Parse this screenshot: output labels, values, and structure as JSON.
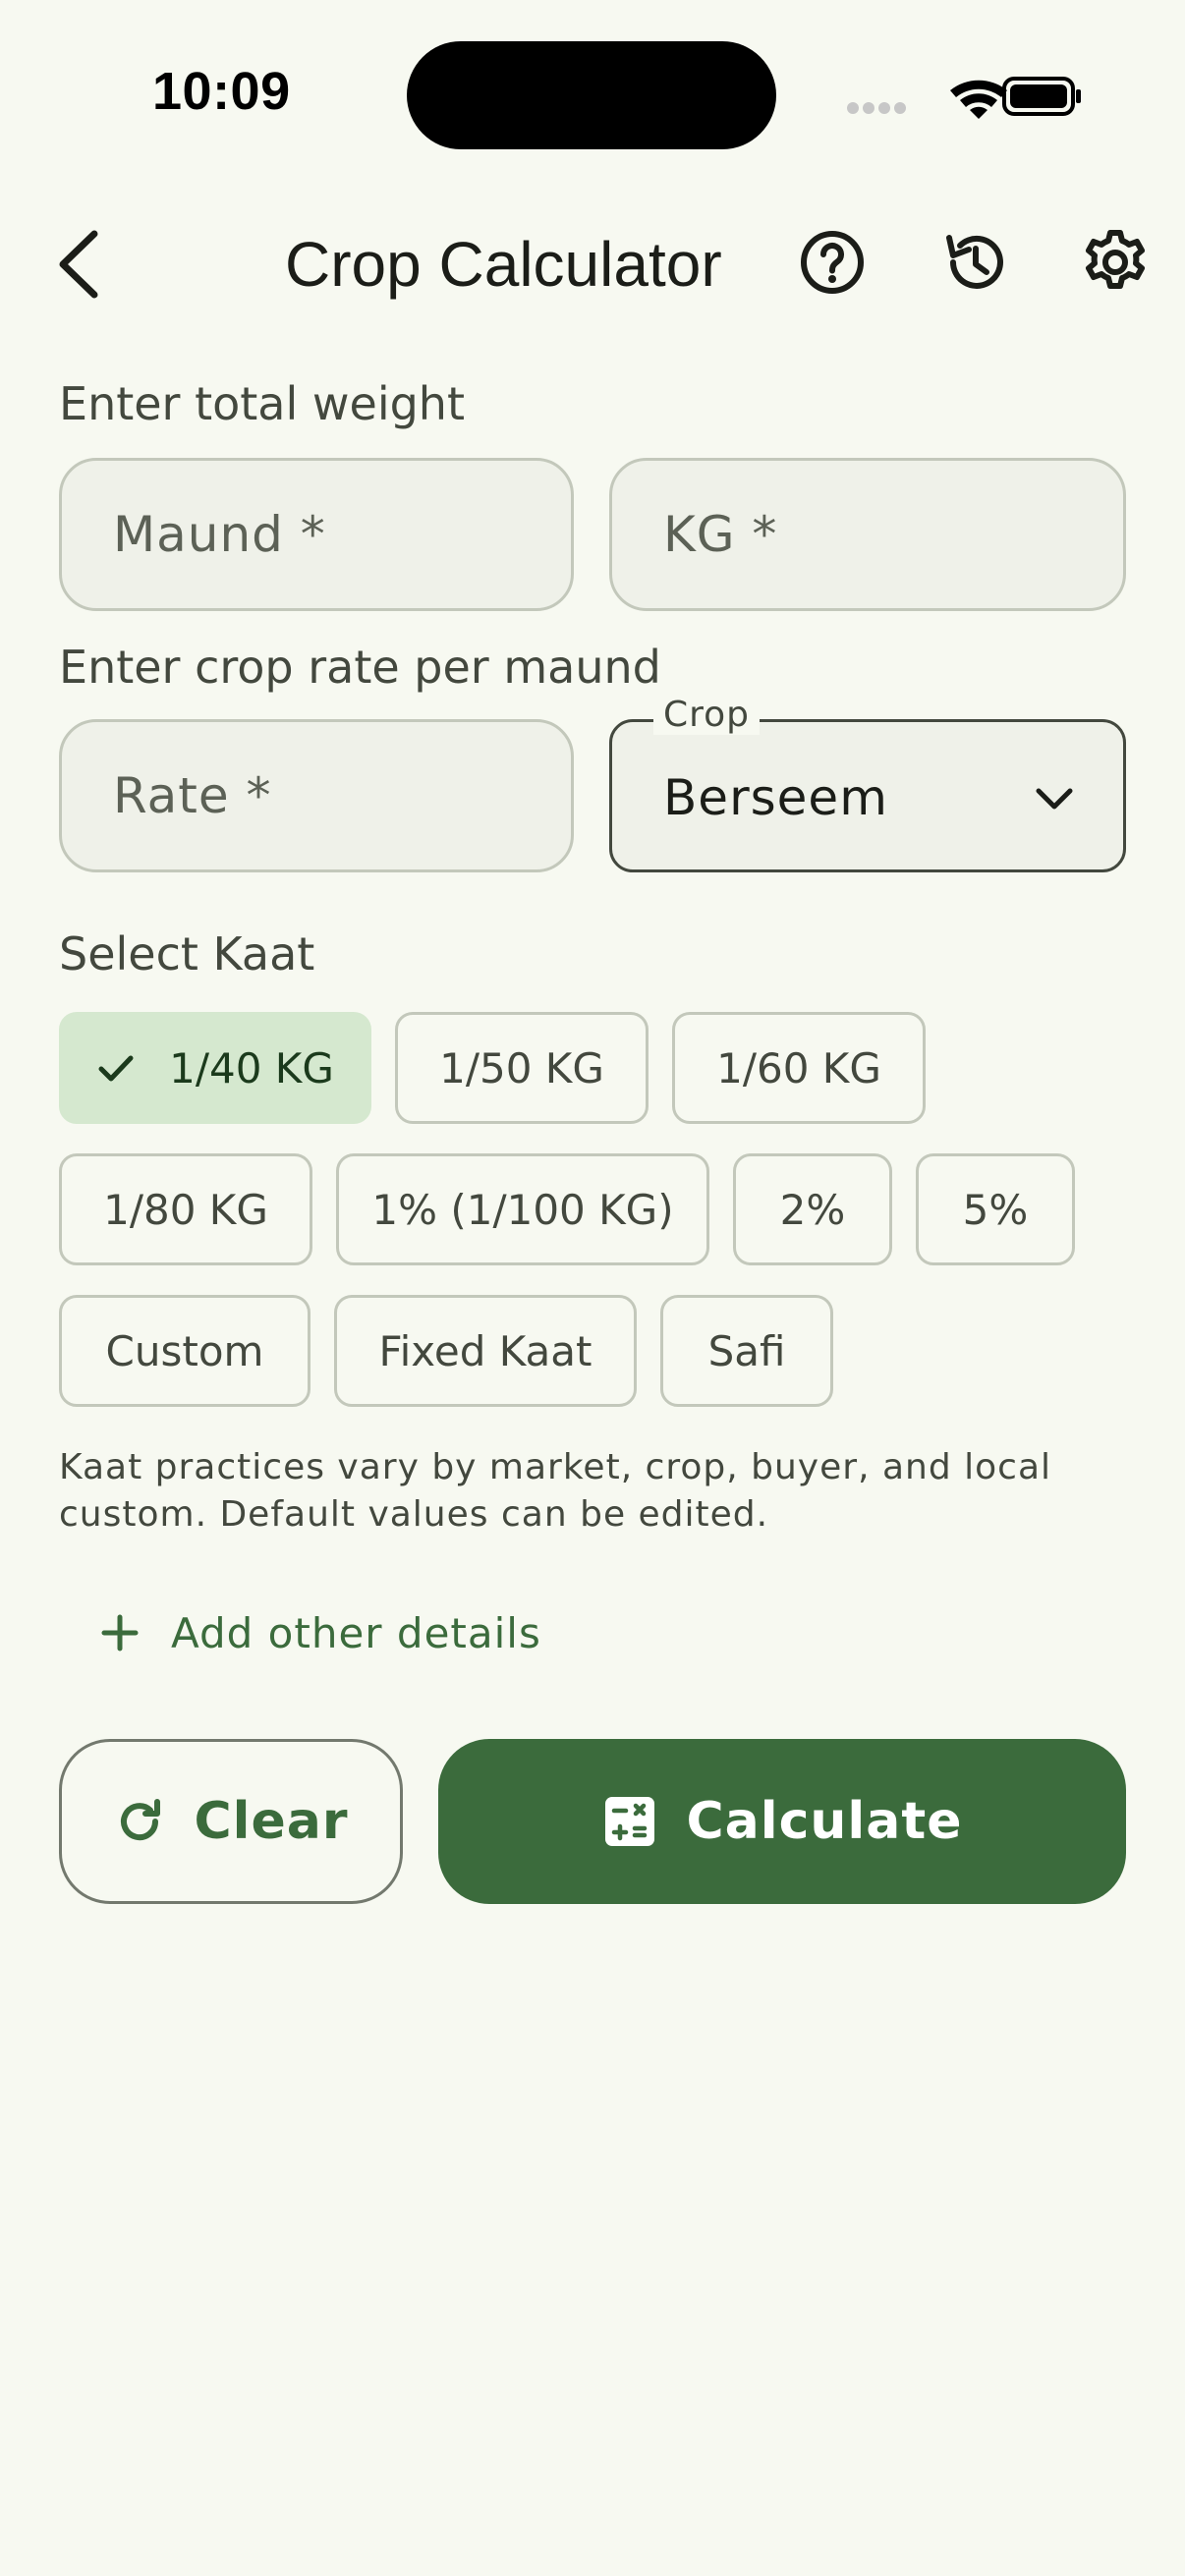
{
  "status_bar": {
    "time": "10:09",
    "icons": [
      "signal-dots-icon",
      "wifi-icon",
      "battery-icon"
    ]
  },
  "app_bar": {
    "title": "Crop Calculator",
    "icons": [
      "back-arrow-icon",
      "help-icon",
      "history-icon",
      "settings-icon"
    ]
  },
  "weight": {
    "label": "Enter total weight",
    "maund_placeholder": "Maund *",
    "kg_placeholder": "KG *"
  },
  "rate": {
    "label": "Enter crop rate per maund",
    "rate_placeholder": "Rate *",
    "crop_label": "Crop",
    "crop_value": "Berseem"
  },
  "kaat": {
    "label": "Select Kaat",
    "options": [
      "1/40 KG",
      "1/50 KG",
      "1/60 KG",
      "1/80 KG",
      "1% (1/100 KG)",
      "2%",
      "5%",
      "Custom",
      "Fixed Kaat",
      "Safi"
    ],
    "selected": "1/40 KG",
    "note": "Kaat practices vary by market, crop, buyer, and local custom. Default values can be edited."
  },
  "add_details": "Add other details",
  "buttons": {
    "clear": "Clear",
    "calculate": "Calculate"
  },
  "colors": {
    "background": "#f7f9f1",
    "primary": "#3b6b3c",
    "chip_selected": "#d5e8cf",
    "field_bg": "#eff1e9"
  }
}
